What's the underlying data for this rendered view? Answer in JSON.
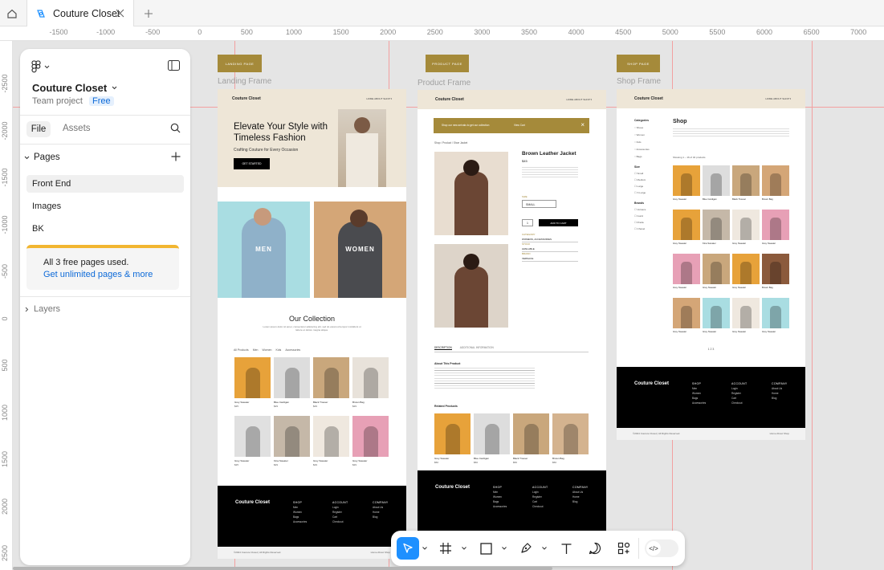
{
  "tab": {
    "title": "Couture Closet"
  },
  "ruler": {
    "top": [
      "-1500",
      "-1000",
      "-500",
      "0",
      "500",
      "1000",
      "1500",
      "2000",
      "2500",
      "3000",
      "3500",
      "4000",
      "4500",
      "5000",
      "5500",
      "6000",
      "6500",
      "7000"
    ],
    "left": [
      "-2500",
      "-2000",
      "-1500",
      "-1000",
      "-500",
      "0",
      "500",
      "1000",
      "1500",
      "2000",
      "2500"
    ]
  },
  "panel": {
    "project_name": "Couture Closet",
    "team": "Team project",
    "plan": "Free",
    "tab_file": "File",
    "tab_assets": "Assets",
    "pages_label": "Pages",
    "pages": [
      "Front End",
      "Images",
      "BK"
    ],
    "limit_text": "All 3 free pages used.",
    "limit_link": "Get unlimited pages & more",
    "layers_label": "Layers"
  },
  "frames": {
    "landing": {
      "chip": "LANDING PAGE",
      "label": "Landing Frame",
      "brand": "Couture Closet",
      "nav": "HOME  ABOUT  SHOP ▾",
      "hero_title": "Elevate Your Style with Timeless Fashion",
      "hero_sub": "Crafting Couture for Every Occasion",
      "cta": "GET STARTED",
      "men": "MEN",
      "women": "WOMEN",
      "collection_title": "Our Collection",
      "collection_desc": "Lorem ipsum dolor sit amet, consectetur adipiscing elit, sed do eiusmod tempor incididunt ut labore et dolore magna aliqua.",
      "filters": [
        "All Products",
        "Men",
        "Women",
        "Kids",
        "Accessories"
      ],
      "products_row1": [
        {
          "name": "Grey Sweater",
          "price": "$25"
        },
        {
          "name": "Blue Cardigan",
          "price": "$29"
        },
        {
          "name": "Black Trouser",
          "price": "$29"
        },
        {
          "name": "Brown Bag",
          "price": "$29"
        }
      ],
      "products_row2": [
        {
          "name": "Grey Sweater",
          "price": "$25"
        },
        {
          "name": "Kina Sweater",
          "price": "$29"
        },
        {
          "name": "Grey Sweater",
          "price": "$29"
        },
        {
          "name": "Grey Sweater",
          "price": "$29"
        }
      ],
      "footer_brand": "Couture Closet",
      "footer_copy": "©2024 Couture Closet | All Rights Reserved.",
      "footer_links": "Home   About   Shop"
    },
    "product": {
      "chip": "PRODUCT PAGE",
      "label": "Product Frame",
      "banner": "Shop our new arrivals to get our collection",
      "banner_link": "View Cart",
      "breadcrumb": "Shop  /  Product  /  Shoe Jacket",
      "title": "Brown Leather Jacket",
      "price": "$45",
      "size_label": "SIZE",
      "size_value": "SMALL",
      "qty": "1",
      "add_to_cart": "ADD TO CART",
      "specs": [
        "CATEGORY",
        "WOMENS, ACCESSORIES",
        "STOCK",
        "AVAILABLE",
        "BRAND",
        "VERSACE"
      ],
      "tabs": [
        "DESCRIPTION",
        "ADDITIONAL INFORMATION"
      ],
      "about_title": "About This Product",
      "related_title": "Related Products",
      "related": [
        {
          "name": "Grey Sweater",
          "price": "$50"
        },
        {
          "name": "Blue Cardigan",
          "price": "$50"
        },
        {
          "name": "Black Trouser",
          "price": "$50"
        },
        {
          "name": "Brown Bag",
          "price": "$50"
        }
      ]
    },
    "shop": {
      "chip": "SHOP PAGE",
      "label": "Shop Frame",
      "title": "Shop",
      "categories_label": "Categories",
      "categories": [
        "Shoes",
        "Women",
        "Kids",
        "Accessories",
        "Bags"
      ],
      "size_label": "Size",
      "sizes": [
        "Small",
        "Medium",
        "Large",
        "X-Large"
      ],
      "brands_label": "Brands",
      "brands": [
        "Versace",
        "Gucci",
        "Prada",
        "Chanel"
      ],
      "showing": "Showing  1 – 16 of 32 products",
      "row_labels": [
        [
          "Grey Sweater",
          "Blue Cardigan",
          "Black Trouser",
          "Brown Bag"
        ],
        [
          "Grey Sweater",
          "Kina Sweater",
          "Grey Sweater",
          "Grey Sweater"
        ],
        [
          "Grey Sweater",
          "Grey Sweater",
          "Grey Sweater",
          "Brown Bag"
        ],
        [
          "Grey Sweater",
          "Grey Sweater",
          "Grey Sweater",
          "Grey Sweater"
        ]
      ],
      "pagination": "1  2  3"
    },
    "footer_cols": {
      "shop_head": "SHOP",
      "shop_items": [
        "Men",
        "Women",
        "Bags",
        "Accessories"
      ],
      "account_head": "ACCOUNT",
      "account_items": [
        "Login",
        "Register",
        "Cart",
        "Checkout"
      ],
      "company_head": "COMPANY",
      "company_items": [
        "About Us",
        "Home",
        "Blog"
      ]
    }
  },
  "toolbar": {
    "tools": [
      "move-tool",
      "frame-tool",
      "shape-tool",
      "pen-tool",
      "text-tool",
      "comment-tool",
      "actions-tool"
    ],
    "accent": "#1e90ff"
  }
}
